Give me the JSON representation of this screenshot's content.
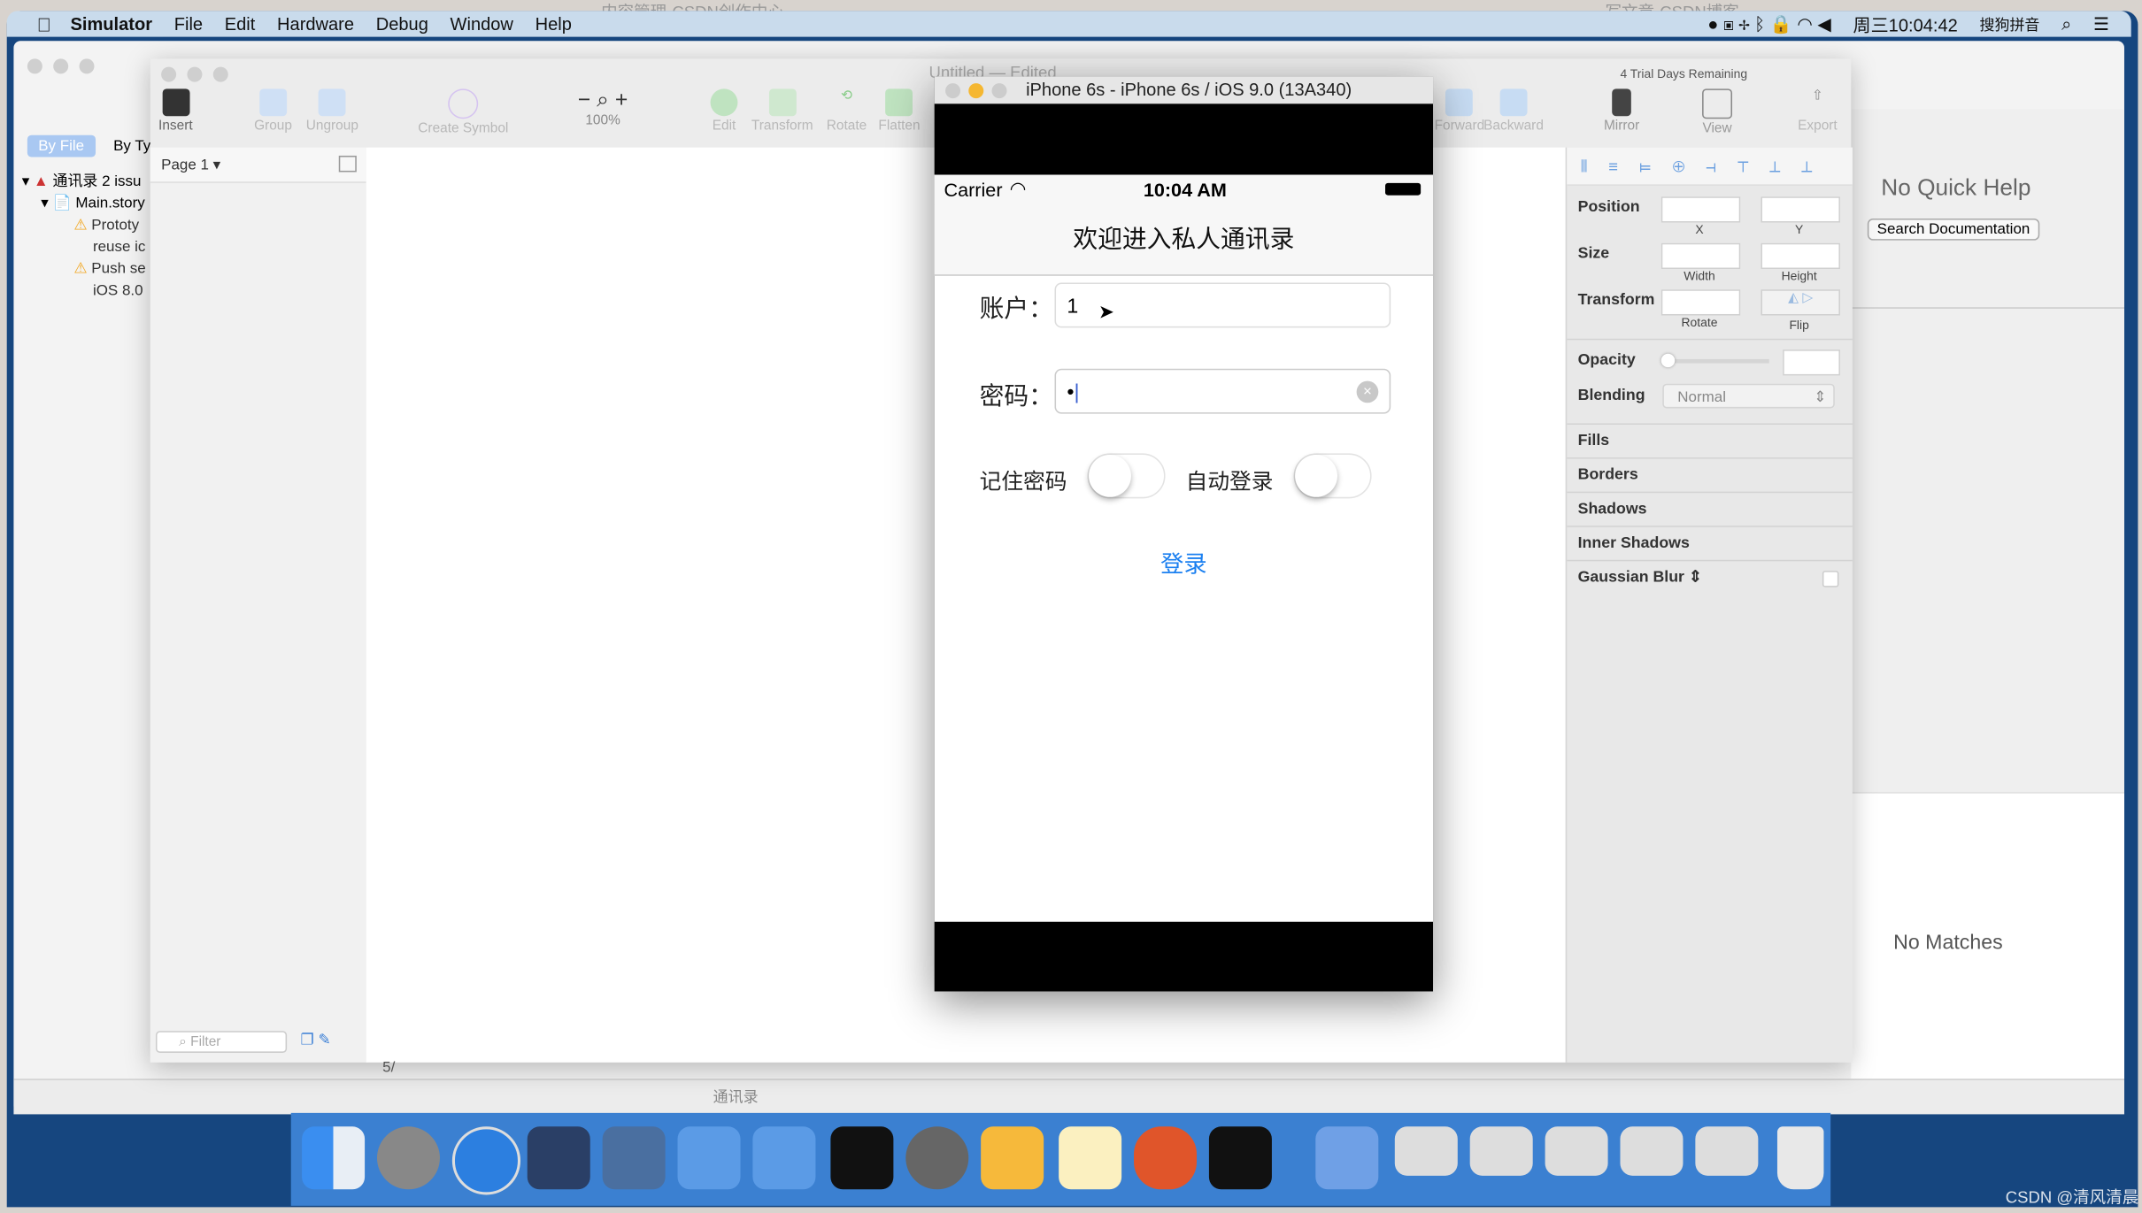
{
  "menubar": {
    "app": "Simulator",
    "items": [
      "File",
      "Edit",
      "Hardware",
      "Debug",
      "Window",
      "Help"
    ],
    "clock": "周三10:04:42",
    "input_method": "搜狗拼音"
  },
  "background_tabs": [
    "内容管理-CSDN创作中心",
    "写文章-CSDN博客"
  ],
  "sketch": {
    "title": "Untitled — Edited",
    "trial": "4 Trial Days Remaining",
    "toolbar": [
      "Insert",
      "Group",
      "Ungroup",
      "Create Symbol",
      "100%",
      "Edit",
      "Transform",
      "Rotate",
      "Flatten",
      "Forward",
      "Backward",
      "Mirror",
      "View",
      "Export"
    ],
    "page": "Page 1",
    "filter_placeholder": "Filter",
    "inspector": {
      "position": "Position",
      "x": "X",
      "y": "Y",
      "size": "Size",
      "width": "Width",
      "height": "Height",
      "transform": "Transform",
      "rotate": "Rotate",
      "flip": "Flip",
      "opacity": "Opacity",
      "blending": "Blending",
      "blending_value": "Normal",
      "sections": [
        "Fills",
        "Borders",
        "Shadows",
        "Inner Shadows",
        "Gaussian Blur"
      ]
    },
    "status": "5/"
  },
  "xcode": {
    "nav_tabs": [
      "By File",
      "By Ty"
    ],
    "tree": [
      "通讯录 2 issu",
      "Main.story",
      "Prototy",
      "reuse ic",
      "Push se",
      "iOS 8.0"
    ],
    "quick_help": "No Quick Help",
    "search_doc": "Search Documentation",
    "no_matches": "No Matches",
    "scheme": "通讯录"
  },
  "simulator": {
    "title": "iPhone 6s - iPhone 6s / iOS 9.0 (13A340)",
    "carrier": "Carrier",
    "time": "10:04 AM",
    "nav_title": "欢迎进入私人通讯录",
    "account_label": "账户：",
    "account_value": "1",
    "password_label": "密码：",
    "password_value": "•",
    "remember_label": "记住密码",
    "remember_on": false,
    "autologin_label": "自动登录",
    "autologin_on": false,
    "login": "登录",
    "accent": "#1a7ff0"
  },
  "dock": [
    "finder",
    "launchpad",
    "safari",
    "mouse",
    "imovie",
    "xcode",
    "simulator",
    "terminal",
    "system-preferences",
    "sketch",
    "notes",
    "powerpoint",
    "console",
    "remote",
    "window1",
    "window2",
    "window3",
    "window4",
    "window5",
    "trash"
  ],
  "watermark": "CSDN @清风清晨"
}
